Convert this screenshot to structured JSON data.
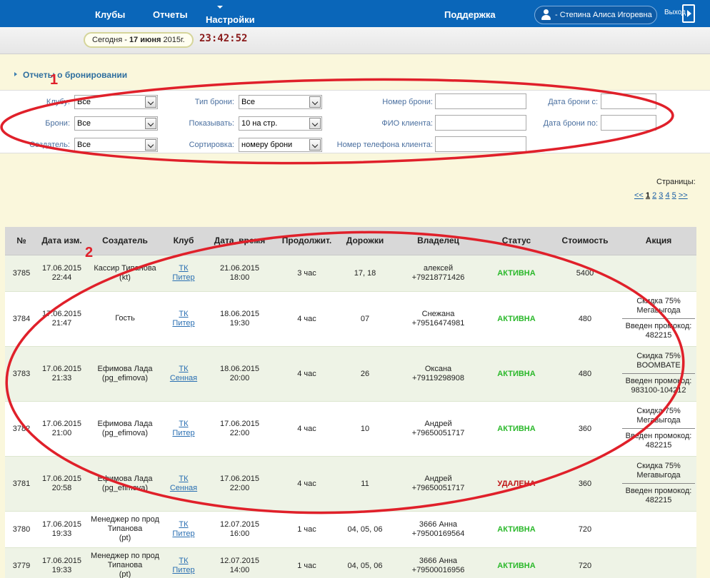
{
  "nav": {
    "items": [
      "Клубы",
      "Отчеты",
      "Настройки"
    ],
    "support": "Поддержка",
    "user": "- Степина Алиса Игоревна",
    "logout": "Выход"
  },
  "datebar": {
    "prefix": "Сегодня - ",
    "date": "17 июня",
    "suffix": " 2015г.",
    "clock": "23:42:52"
  },
  "section_title": "Отчеты о бронировании",
  "filters": {
    "club_label": "Клубу:",
    "club_value": "Все",
    "bookings_label": "Брони:",
    "bookings_value": "Все",
    "creator_label": "Создатель:",
    "creator_value": "Все",
    "type_label": "Тип брони:",
    "type_value": "Все",
    "show_label": "Показывать:",
    "show_value": "10 на стр.",
    "sort_label": "Сортировка:",
    "sort_value": "номеру брони",
    "number_label": "Номер брони:",
    "name_label": "ФИО клиента:",
    "phone_label": "Номер телефона клиента:",
    "date_from_label": "Дата брони с:",
    "date_to_label": "Дата брони по:"
  },
  "pagination": {
    "label": "Страницы:",
    "first": "<<",
    "pages": [
      "1",
      "2",
      "3",
      "4",
      "5"
    ],
    "current": "1",
    "next": ">>"
  },
  "table": {
    "headers": [
      "№",
      "Дата изм.",
      "Создатель",
      "Клуб",
      "Дата, время",
      "Продолжит.",
      "Дорожки",
      "Владелец",
      "Статус",
      "Стоимость",
      "Акция"
    ],
    "rows": [
      {
        "num": "3785",
        "date": "17.06.2015",
        "time": "22:44",
        "creator1": "Кассир Типанова",
        "creator2": "(kt)",
        "club1": "ТК",
        "club2": "Питер",
        "dt1": "21.06.2015",
        "dt2": "18:00",
        "dur": "3 час",
        "lanes": "17, 18",
        "owner1": "алексей",
        "owner2": "+79218771426",
        "status": "АКТИВНА",
        "status_kind": "active",
        "cost": "5400",
        "promo1": "",
        "promo2": ""
      },
      {
        "num": "3784",
        "date": "17.06.2015",
        "time": "21:47",
        "creator1": "Гость",
        "creator2": "",
        "club1": "ТК",
        "club2": "Питер",
        "dt1": "18.06.2015",
        "dt2": "19:30",
        "dur": "4 час",
        "lanes": "07",
        "owner1": "Снежана",
        "owner2": "+79516474981",
        "status": "АКТИВНА",
        "status_kind": "active",
        "cost": "480",
        "promo1": "Скидка 75% Мегавыгода",
        "promo2": "Введен промокод: 482215"
      },
      {
        "num": "3783",
        "date": "17.06.2015",
        "time": "21:33",
        "creator1": "Ефимова Лада",
        "creator2": "(pg_efimova)",
        "club1": "ТК",
        "club2": "Сенная",
        "dt1": "18.06.2015",
        "dt2": "20:00",
        "dur": "4 час",
        "lanes": "26",
        "owner1": "Оксана",
        "owner2": "+79119298908",
        "status": "АКТИВНА",
        "status_kind": "active",
        "cost": "480",
        "promo1": "Скидка 75% BOOMBATE",
        "promo2": "Введен промокод: 983100-104212"
      },
      {
        "num": "3782",
        "date": "17.06.2015",
        "time": "21:00",
        "creator1": "Ефимова Лада",
        "creator2": "(pg_efimova)",
        "club1": "ТК",
        "club2": "Питер",
        "dt1": "17.06.2015",
        "dt2": "22:00",
        "dur": "4 час",
        "lanes": "10",
        "owner1": "Андрей",
        "owner2": "+79650051717",
        "status": "АКТИВНА",
        "status_kind": "active",
        "cost": "360",
        "promo1": "Скидка 75% Мегавыгода",
        "promo2": "Введен промокод: 482215"
      },
      {
        "num": "3781",
        "date": "17.06.2015",
        "time": "20:58",
        "creator1": "Ефимова Лада",
        "creator2": "(pg_efimova)",
        "club1": "ТК",
        "club2": "Сенная",
        "dt1": "17.06.2015",
        "dt2": "22:00",
        "dur": "4 час",
        "lanes": "11",
        "owner1": "Андрей",
        "owner2": "+79650051717",
        "status": "УДАЛЕНА",
        "status_kind": "deleted",
        "cost": "360",
        "promo1": "Скидка 75% Мегавыгода",
        "promo2": "Введен промокод: 482215"
      },
      {
        "num": "3780",
        "date": "17.06.2015",
        "time": "19:33",
        "creator1": "Менеджер по прод Типанова",
        "creator2": "(pt)",
        "club1": "ТК",
        "club2": "Питер",
        "dt1": "12.07.2015",
        "dt2": "16:00",
        "dur": "1 час",
        "lanes": "04, 05, 06",
        "owner1": "3666 Анна",
        "owner2": "+79500169564",
        "status": "АКТИВНА",
        "status_kind": "active",
        "cost": "720",
        "promo1": "",
        "promo2": ""
      },
      {
        "num": "3779",
        "date": "17.06.2015",
        "time": "19:33",
        "creator1": "Менеджер по прод Типанова",
        "creator2": "(pt)",
        "club1": "ТК",
        "club2": "Питер",
        "dt1": "12.07.2015",
        "dt2": "14:00",
        "dur": "1 час",
        "lanes": "04, 05, 06",
        "owner1": "3666 Анна",
        "owner2": "+79500016956",
        "status": "АКТИВНА",
        "status_kind": "active",
        "cost": "720",
        "promo1": "",
        "promo2": ""
      }
    ]
  },
  "annotations": {
    "label1": "1",
    "label2": "2",
    "color": "#e0202a"
  },
  "colors": {
    "nav": "#0a66b9",
    "active": "#2ab82a",
    "deleted": "#c01616",
    "link": "#2a6fb2"
  }
}
